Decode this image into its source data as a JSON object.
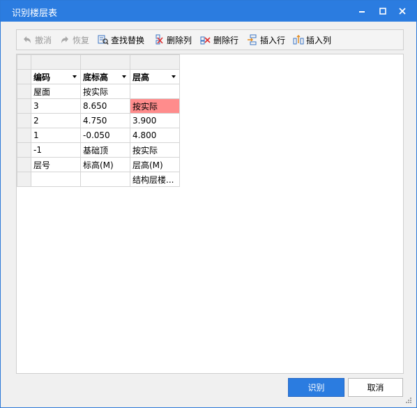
{
  "window": {
    "title": "识别楼层表"
  },
  "toolbar": {
    "undo": "撤消",
    "redo": "恢复",
    "find_replace": "查找替换",
    "delete_col": "删除列",
    "delete_row": "删除行",
    "insert_row": "插入行",
    "insert_col": "插入列"
  },
  "table": {
    "headers": [
      "编码",
      "底标高",
      "层高"
    ],
    "rows": [
      [
        "屋面",
        "按实际",
        ""
      ],
      [
        "3",
        "8.650",
        "按实际"
      ],
      [
        "2",
        "4.750",
        "3.900"
      ],
      [
        "1",
        "-0.050",
        "4.800"
      ],
      [
        "-1",
        "基础顶",
        "按实际"
      ],
      [
        "层号",
        "标高(M)",
        "层高(M)"
      ],
      [
        "",
        "",
        "结构层楼..."
      ]
    ]
  },
  "buttons": {
    "ok": "识别",
    "cancel": "取消"
  },
  "background": {
    "glyph": "层"
  },
  "colors": {
    "title_bar": "#2b7ce0",
    "highlight_cell": "#ff8c8c",
    "primary_button": "#2b7ce0"
  }
}
